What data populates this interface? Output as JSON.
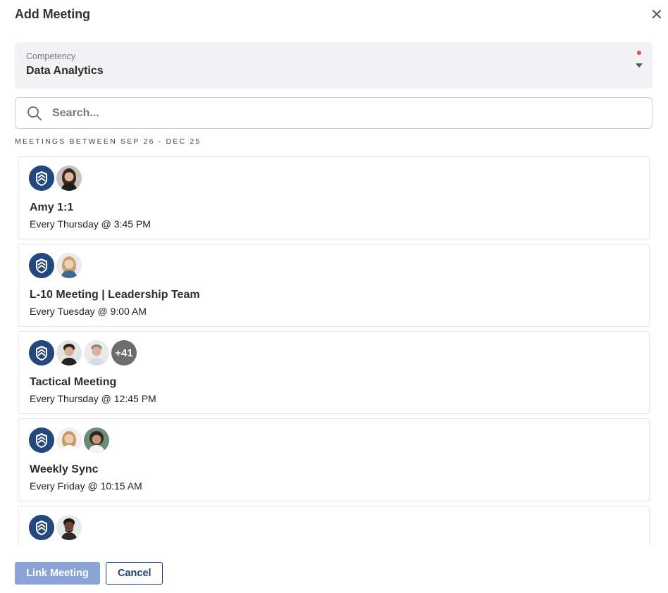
{
  "dialog": {
    "title": "Add Meeting",
    "close_icon": "close-icon"
  },
  "competency": {
    "label": "Competency",
    "value": "Data Analytics",
    "required_color": "#e5484d"
  },
  "search": {
    "placeholder": "Search..."
  },
  "range_label": "MEETINGS BETWEEN SEP 26 - DEC 25",
  "meetings": [
    {
      "title": "Amy 1:1",
      "schedule": "Every Thursday @ 3:45 PM",
      "avatars": [
        "org-shield-icon",
        "person-avatar"
      ]
    },
    {
      "title": "L-10 Meeting | Leadership Team",
      "schedule": "Every Tuesday @ 9:00 AM",
      "avatars": [
        "org-shield-icon",
        "person-avatar"
      ]
    },
    {
      "title": "Tactical Meeting",
      "schedule": "Every Thursday @ 12:45 PM",
      "avatars": [
        "org-shield-icon",
        "person-avatar",
        "person-avatar"
      ],
      "more_count": "+41"
    },
    {
      "title": "Weekly Sync",
      "schedule": "Every Friday @ 10:15 AM",
      "avatars": [
        "org-shield-icon",
        "person-avatar",
        "person-avatar"
      ]
    },
    {
      "title": "",
      "schedule": "",
      "avatars": [
        "org-shield-icon",
        "person-avatar"
      ]
    }
  ],
  "footer": {
    "primary_label": "Link Meeting",
    "secondary_label": "Cancel"
  },
  "colors": {
    "brand": "#23487e",
    "primary_disabled": "#8aa4d6"
  }
}
